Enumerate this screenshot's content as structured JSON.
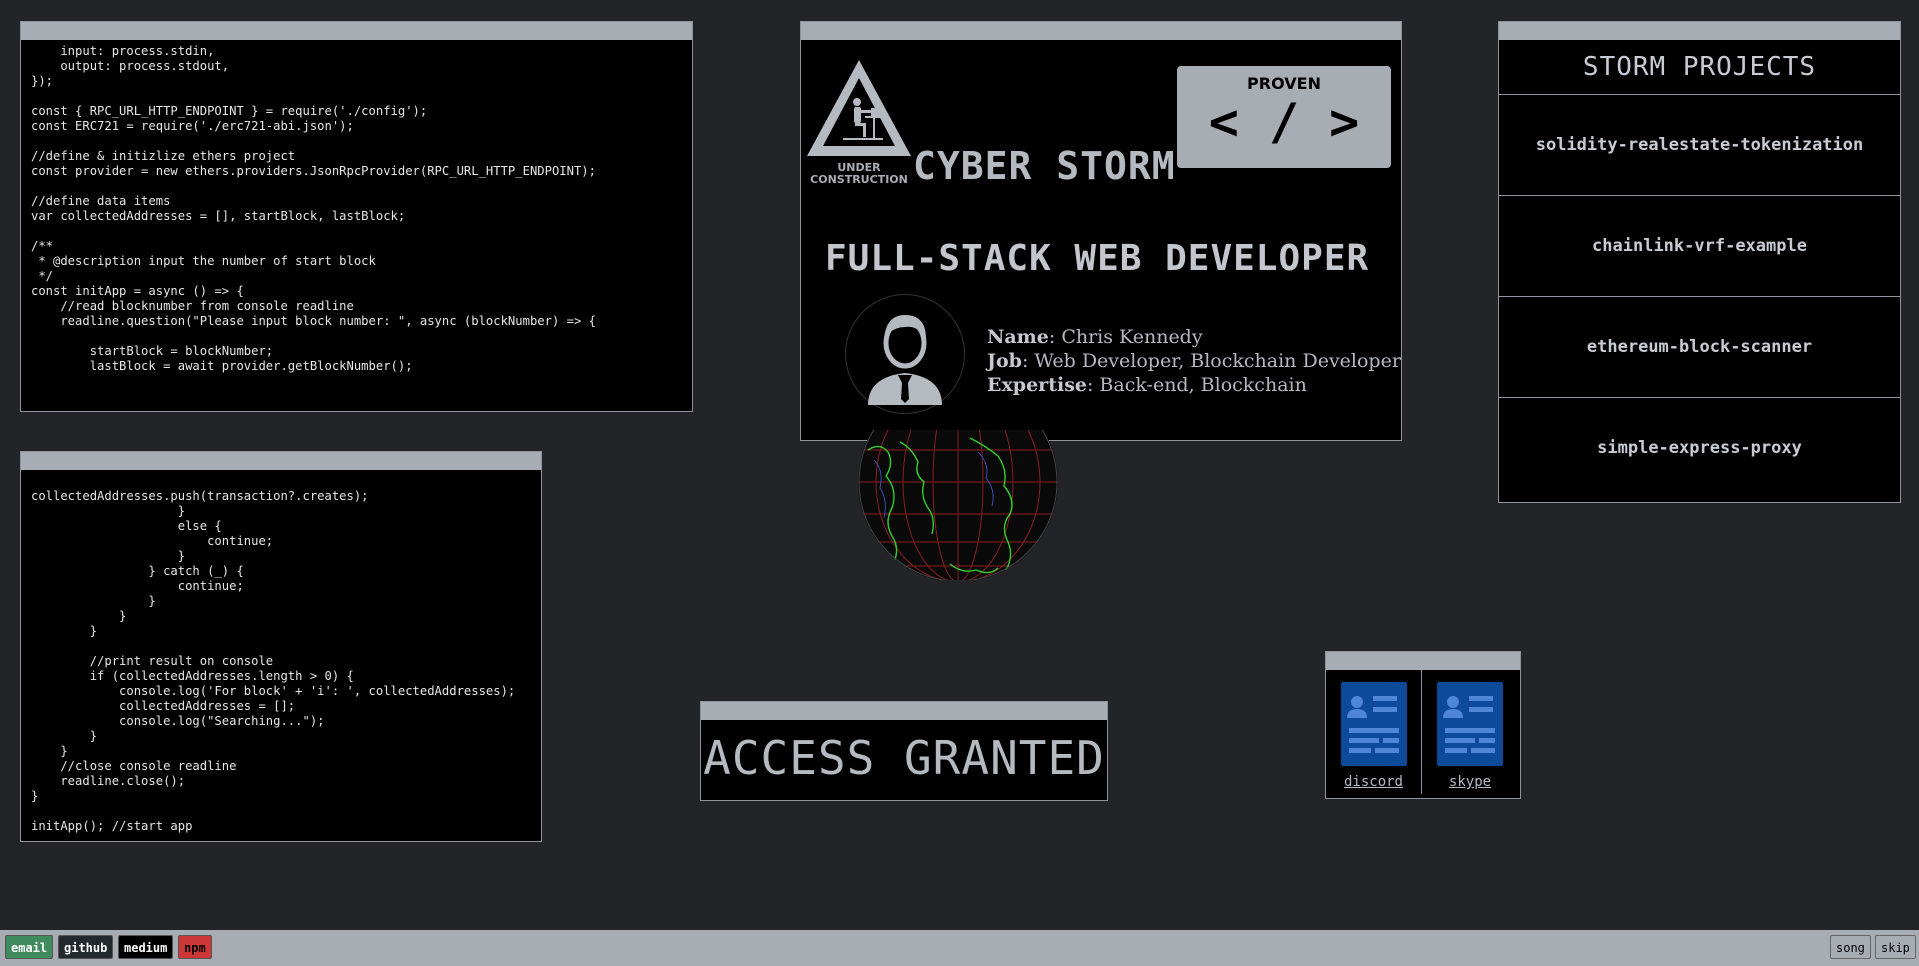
{
  "code_top": {
    "lines": [
      "    input: process.stdin,",
      "    output: process.stdout,",
      "});",
      "",
      "const { RPC_URL_HTTP_ENDPOINT } = require('./config');",
      "const ERC721 = require('./erc721-abi.json');",
      "",
      "//define & initizlize ethers project",
      "const provider = new ethers.providers.JsonRpcProvider(RPC_URL_HTTP_ENDPOINT);",
      "",
      "//define data items",
      "var collectedAddresses = [], startBlock, lastBlock;",
      "",
      "/**",
      " * @description input the number of start block",
      " */",
      "const initApp = async () => {",
      "    //read blocknumber from console readline",
      "    readline.question(\"Please input block number: \", async (blockNumber) => {",
      "",
      "        startBlock = blockNumber;",
      "        lastBlock = await provider.getBlockNumber();"
    ]
  },
  "code_bottom": {
    "lines": [
      "",
      "collectedAddresses.push(transaction?.creates);",
      "                    }",
      "                    else {",
      "                        continue;",
      "                    }",
      "                } catch (_) {",
      "                    continue;",
      "                }",
      "            }",
      "        }",
      "",
      "        //print result on console",
      "        if (collectedAddresses.length > 0) {",
      "            console.log('For block' + 'i': ', collectedAddresses);",
      "            collectedAddresses = [];",
      "            console.log(\"Searching...\");",
      "        }",
      "    }",
      "    //close console readline",
      "    readline.close();",
      "}",
      "",
      "initApp(); //start app"
    ]
  },
  "profile": {
    "under_construction": "UNDER CONSTRUCTION",
    "brand": "CYBER STORM",
    "proven_title": "PROVEN",
    "proven_code": "< / >",
    "headline": "FULL-STACK WEB DEVELOPER",
    "name_label": "Name",
    "name_value": ": Chris Kennedy",
    "job_label": "Job",
    "job_value": ": Web Developer, Blockchain Developer",
    "expertise_label": "Expertise",
    "expertise_value": ": Back-end, Blockchain"
  },
  "projects": {
    "title": "STORM PROJECTS",
    "items": [
      "solidity-realestate-tokenization",
      "chainlink-vrf-example",
      "ethereum-block-scanner",
      "simple-express-proxy"
    ]
  },
  "access": {
    "text": "ACCESS GRANTED"
  },
  "contacts": {
    "items": [
      {
        "label": "discord",
        "icon": "contact-card-icon"
      },
      {
        "label": "skype",
        "icon": "contact-card-icon"
      }
    ]
  },
  "taskbar": {
    "left": [
      {
        "label": "email",
        "color": "#3f8b5e"
      },
      {
        "label": "github",
        "color": "#24292e"
      },
      {
        "label": "medium",
        "color": "#000000"
      },
      {
        "label": "npm",
        "color": "#cb3837"
      }
    ],
    "right": [
      "song",
      "skip"
    ]
  },
  "colors": {
    "background": "#222427",
    "window_bar": "#a8acb3",
    "text": "#c8ccd2",
    "icon_blue": "#0d4a9a"
  }
}
